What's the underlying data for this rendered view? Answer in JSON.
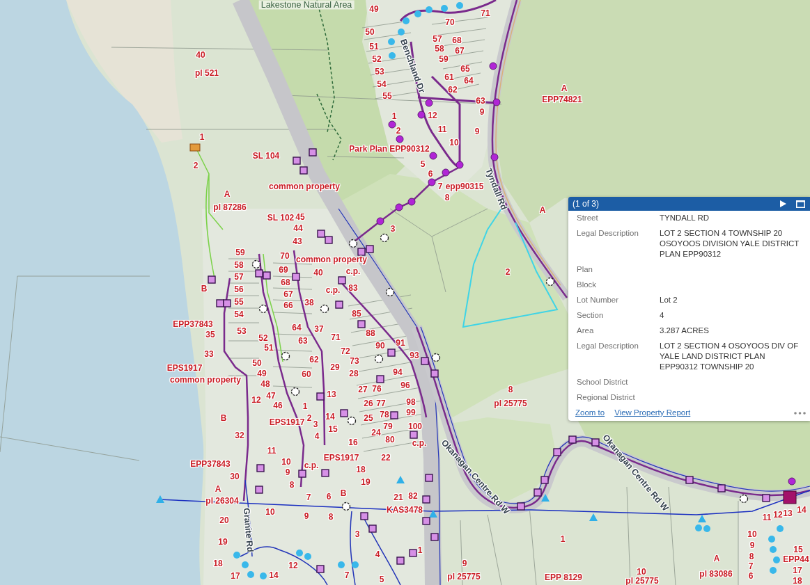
{
  "map": {
    "labels": [
      {
        "text": "Lakestone Natural Area",
        "kind": "place"
      },
      {
        "text": "49",
        "kind": "parcel"
      },
      {
        "text": "71",
        "kind": "parcel"
      },
      {
        "text": "70",
        "kind": "parcel"
      },
      {
        "text": "50",
        "kind": "parcel"
      },
      {
        "text": "57",
        "kind": "parcel"
      },
      {
        "text": "68",
        "kind": "parcel"
      },
      {
        "text": "51",
        "kind": "parcel"
      },
      {
        "text": "58",
        "kind": "parcel"
      },
      {
        "text": "40",
        "kind": "parcel"
      },
      {
        "text": "67",
        "kind": "parcel"
      },
      {
        "text": "52",
        "kind": "parcel"
      },
      {
        "text": "59",
        "kind": "parcel"
      },
      {
        "text": "pl 521",
        "kind": "parcel"
      },
      {
        "text": "53",
        "kind": "parcel"
      },
      {
        "text": "65",
        "kind": "parcel"
      },
      {
        "text": "61",
        "kind": "parcel"
      },
      {
        "text": "54",
        "kind": "parcel"
      },
      {
        "text": "64",
        "kind": "parcel"
      },
      {
        "text": "62",
        "kind": "parcel"
      },
      {
        "text": "A",
        "kind": "parcel"
      },
      {
        "text": "55",
        "kind": "parcel"
      },
      {
        "text": "63",
        "kind": "parcel"
      },
      {
        "text": "EPP74821",
        "kind": "parcel"
      },
      {
        "text": "1",
        "kind": "parcel"
      },
      {
        "text": "12",
        "kind": "parcel"
      },
      {
        "text": "9",
        "kind": "parcel"
      },
      {
        "text": "2",
        "kind": "parcel"
      },
      {
        "text": "11",
        "kind": "parcel"
      },
      {
        "text": "9",
        "kind": "parcel"
      },
      {
        "text": "1",
        "kind": "parcel"
      },
      {
        "text": "10",
        "kind": "parcel"
      },
      {
        "text": "Park Plan EPP90312",
        "kind": "parcel"
      },
      {
        "text": "SL 104",
        "kind": "parcel"
      },
      {
        "text": "2",
        "kind": "parcel"
      },
      {
        "text": "5",
        "kind": "parcel"
      },
      {
        "text": "6",
        "kind": "parcel"
      },
      {
        "text": "common property",
        "kind": "parcel"
      },
      {
        "text": "7",
        "kind": "parcel"
      },
      {
        "text": "epp90315",
        "kind": "parcel"
      },
      {
        "text": "A",
        "kind": "parcel"
      },
      {
        "text": "8",
        "kind": "parcel"
      },
      {
        "text": "pl 87286",
        "kind": "parcel"
      },
      {
        "text": "A",
        "kind": "parcel"
      },
      {
        "text": "SL 102",
        "kind": "parcel"
      },
      {
        "text": "45",
        "kind": "parcel"
      },
      {
        "text": "44",
        "kind": "parcel"
      },
      {
        "text": "3",
        "kind": "parcel"
      },
      {
        "text": "43",
        "kind": "parcel"
      },
      {
        "text": "59",
        "kind": "parcel"
      },
      {
        "text": "70",
        "kind": "parcel"
      },
      {
        "text": "common property",
        "kind": "parcel"
      },
      {
        "text": "58",
        "kind": "parcel"
      },
      {
        "text": "69",
        "kind": "parcel"
      },
      {
        "text": "40",
        "kind": "parcel"
      },
      {
        "text": "c.p.",
        "kind": "parcel"
      },
      {
        "text": "57",
        "kind": "parcel"
      },
      {
        "text": "2",
        "kind": "parcel"
      },
      {
        "text": "68",
        "kind": "parcel"
      },
      {
        "text": "B",
        "kind": "parcel"
      },
      {
        "text": "56",
        "kind": "parcel"
      },
      {
        "text": "c.p.",
        "kind": "parcel"
      },
      {
        "text": "83",
        "kind": "parcel"
      },
      {
        "text": "67",
        "kind": "parcel"
      },
      {
        "text": "55",
        "kind": "parcel"
      },
      {
        "text": "66",
        "kind": "parcel"
      },
      {
        "text": "38",
        "kind": "parcel"
      },
      {
        "text": "54",
        "kind": "parcel"
      },
      {
        "text": "85",
        "kind": "parcel"
      },
      {
        "text": "EPP37843",
        "kind": "parcel"
      },
      {
        "text": "53",
        "kind": "parcel"
      },
      {
        "text": "64",
        "kind": "parcel"
      },
      {
        "text": "37",
        "kind": "parcel"
      },
      {
        "text": "35",
        "kind": "parcel"
      },
      {
        "text": "52",
        "kind": "parcel"
      },
      {
        "text": "71",
        "kind": "parcel"
      },
      {
        "text": "88",
        "kind": "parcel"
      },
      {
        "text": "63",
        "kind": "parcel"
      },
      {
        "text": "51",
        "kind": "parcel"
      },
      {
        "text": "90",
        "kind": "parcel"
      },
      {
        "text": "91",
        "kind": "parcel"
      },
      {
        "text": "33",
        "kind": "parcel"
      },
      {
        "text": "72",
        "kind": "parcel"
      },
      {
        "text": "62",
        "kind": "parcel"
      },
      {
        "text": "93",
        "kind": "parcel"
      },
      {
        "text": "50",
        "kind": "parcel"
      },
      {
        "text": "73",
        "kind": "parcel"
      },
      {
        "text": "EPS1917",
        "kind": "parcel"
      },
      {
        "text": "29",
        "kind": "parcel"
      },
      {
        "text": "49",
        "kind": "parcel"
      },
      {
        "text": "60",
        "kind": "parcel"
      },
      {
        "text": "28",
        "kind": "parcel"
      },
      {
        "text": "94",
        "kind": "parcel"
      },
      {
        "text": "common property",
        "kind": "parcel"
      },
      {
        "text": "48",
        "kind": "parcel"
      },
      {
        "text": "27",
        "kind": "parcel"
      },
      {
        "text": "76",
        "kind": "parcel"
      },
      {
        "text": "96",
        "kind": "parcel"
      },
      {
        "text": "13",
        "kind": "parcel"
      },
      {
        "text": "8",
        "kind": "parcel"
      },
      {
        "text": "12",
        "kind": "parcel"
      },
      {
        "text": "47",
        "kind": "parcel"
      },
      {
        "text": "46",
        "kind": "parcel"
      },
      {
        "text": "1",
        "kind": "parcel"
      },
      {
        "text": "26",
        "kind": "parcel"
      },
      {
        "text": "77",
        "kind": "parcel"
      },
      {
        "text": "98",
        "kind": "parcel"
      },
      {
        "text": "pl 25775",
        "kind": "parcel"
      },
      {
        "text": "B",
        "kind": "parcel"
      },
      {
        "text": "2",
        "kind": "parcel"
      },
      {
        "text": "14",
        "kind": "parcel"
      },
      {
        "text": "25",
        "kind": "parcel"
      },
      {
        "text": "78",
        "kind": "parcel"
      },
      {
        "text": "99",
        "kind": "parcel"
      },
      {
        "text": "EPS1917",
        "kind": "parcel"
      },
      {
        "text": "3",
        "kind": "parcel"
      },
      {
        "text": "15",
        "kind": "parcel"
      },
      {
        "text": "79",
        "kind": "parcel"
      },
      {
        "text": "100",
        "kind": "parcel"
      },
      {
        "text": "32",
        "kind": "parcel"
      },
      {
        "text": "4",
        "kind": "parcel"
      },
      {
        "text": "24",
        "kind": "parcel"
      },
      {
        "text": "16",
        "kind": "parcel"
      },
      {
        "text": "80",
        "kind": "parcel"
      },
      {
        "text": "c.p.",
        "kind": "parcel"
      },
      {
        "text": "11",
        "kind": "parcel"
      },
      {
        "text": "10",
        "kind": "parcel"
      },
      {
        "text": "EPS1917",
        "kind": "parcel"
      },
      {
        "text": "22",
        "kind": "parcel"
      },
      {
        "text": "EPP37843",
        "kind": "parcel"
      },
      {
        "text": "c.p.",
        "kind": "parcel"
      },
      {
        "text": "9",
        "kind": "parcel"
      },
      {
        "text": "18",
        "kind": "parcel"
      },
      {
        "text": "30",
        "kind": "parcel"
      },
      {
        "text": "8",
        "kind": "parcel"
      },
      {
        "text": "19",
        "kind": "parcel"
      },
      {
        "text": "A",
        "kind": "parcel"
      },
      {
        "text": "pl 26304",
        "kind": "parcel"
      },
      {
        "text": "7",
        "kind": "parcel"
      },
      {
        "text": "6",
        "kind": "parcel"
      },
      {
        "text": "B",
        "kind": "parcel"
      },
      {
        "text": "21",
        "kind": "parcel"
      },
      {
        "text": "82",
        "kind": "parcel"
      },
      {
        "text": "10",
        "kind": "parcel"
      },
      {
        "text": "KAS3478",
        "kind": "parcel"
      },
      {
        "text": "9",
        "kind": "parcel"
      },
      {
        "text": "12",
        "kind": "parcel"
      },
      {
        "text": "13",
        "kind": "parcel"
      },
      {
        "text": "14",
        "kind": "parcel"
      },
      {
        "text": "20",
        "kind": "parcel"
      },
      {
        "text": "8",
        "kind": "parcel"
      },
      {
        "text": "11",
        "kind": "parcel"
      },
      {
        "text": "3",
        "kind": "parcel"
      },
      {
        "text": "1",
        "kind": "parcel"
      },
      {
        "text": "10",
        "kind": "parcel"
      },
      {
        "text": "19",
        "kind": "parcel"
      },
      {
        "text": "1",
        "kind": "parcel"
      },
      {
        "text": "9",
        "kind": "parcel"
      },
      {
        "text": "4",
        "kind": "parcel"
      },
      {
        "text": "A",
        "kind": "parcel"
      },
      {
        "text": "8",
        "kind": "parcel"
      },
      {
        "text": "15",
        "kind": "parcel"
      },
      {
        "text": "18",
        "kind": "parcel"
      },
      {
        "text": "12",
        "kind": "parcel"
      },
      {
        "text": "9",
        "kind": "parcel"
      },
      {
        "text": "EPP44",
        "kind": "parcel"
      },
      {
        "text": "7",
        "kind": "parcel"
      },
      {
        "text": "17",
        "kind": "parcel"
      },
      {
        "text": "14",
        "kind": "parcel"
      },
      {
        "text": "7",
        "kind": "parcel"
      },
      {
        "text": "pl 25775",
        "kind": "parcel"
      },
      {
        "text": "EPP 8129",
        "kind": "parcel"
      },
      {
        "text": "10",
        "kind": "parcel"
      },
      {
        "text": "pl 83086",
        "kind": "parcel"
      },
      {
        "text": "6",
        "kind": "parcel"
      },
      {
        "text": "17",
        "kind": "parcel"
      },
      {
        "text": "5",
        "kind": "parcel"
      },
      {
        "text": "pl 25775",
        "kind": "parcel"
      },
      {
        "text": "18",
        "kind": "parcel"
      }
    ],
    "road_names": [
      "Benchland Dr",
      "Tyndall Rd",
      "Okanagan Centre Rd W",
      "Okanagan Centre Rd W",
      "Granite Rd"
    ]
  },
  "popup": {
    "title": "(1 of 3)",
    "fields": [
      {
        "label": "Street",
        "value": "TYNDALL RD"
      },
      {
        "label": "Legal Description",
        "value": "LOT 2 SECTION 4 TOWNSHIP 20 OSOYOOS DIVISION YALE DISTRICT PLAN EPP90312"
      },
      {
        "label": "Plan"
      },
      {
        "label": "Block"
      },
      {
        "label": "Lot Number",
        "value": "Lot 2"
      },
      {
        "label": "Section",
        "value": "4"
      },
      {
        "label": "Area",
        "value": "3.287 ACRES"
      },
      {
        "label": "Legal Description",
        "value": "LOT 2 SECTION 4 OSOYOOS DIV OF YALE LAND DISTRICT PLAN EPP90312 TOWNSHIP 20"
      },
      {
        "label": "School District"
      },
      {
        "label": "Regional District"
      }
    ],
    "links": [
      "Zoom to",
      "View Property Report"
    ]
  }
}
